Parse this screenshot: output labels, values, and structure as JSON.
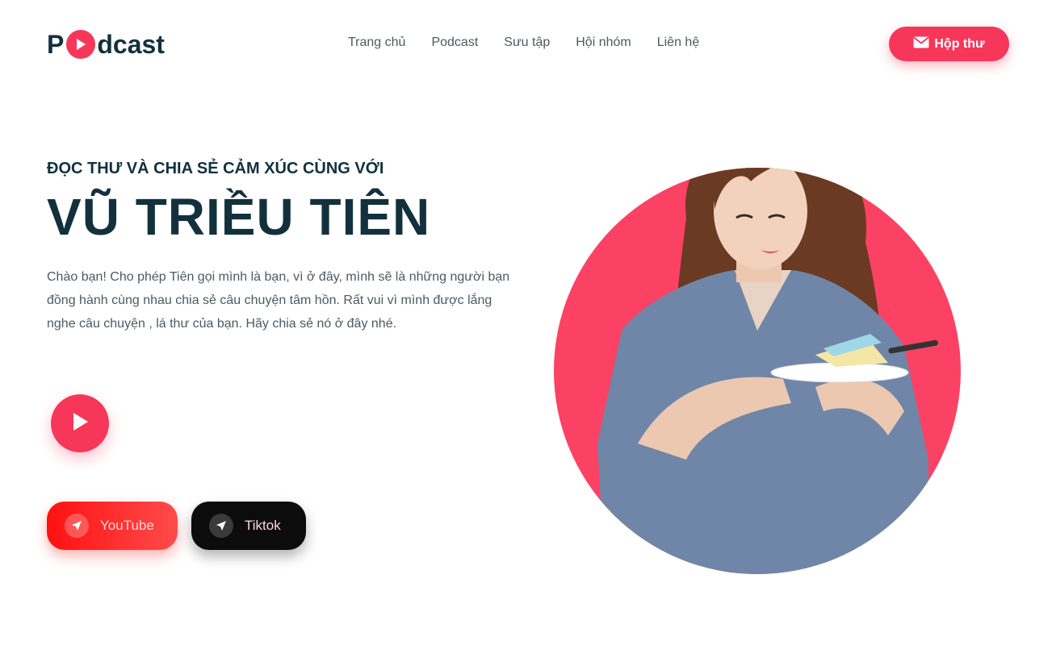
{
  "brand": {
    "logo_prefix": "P",
    "logo_suffix": "dcast",
    "logo_icon": "play-icon"
  },
  "nav": {
    "items": [
      {
        "label": "Trang chủ"
      },
      {
        "label": "Podcast"
      },
      {
        "label": "Sưu tập"
      },
      {
        "label": "Hội nhóm"
      },
      {
        "label": "Liên hệ"
      }
    ]
  },
  "header": {
    "inbox_label": "Hộp thư",
    "inbox_icon": "envelope-icon"
  },
  "hero": {
    "kicker": "ĐỌC THƯ VÀ CHIA SẺ CẢM XÚC CÙNG VỚI",
    "name": "VŨ TRIỀU TIÊN",
    "description": "Chào bạn! Cho phép Tiên gọi mình là bạn, vì ở đây, mình sẽ là những người bạn đồng hành cùng nhau chia sẻ câu chuyện tâm hồn. Rất vui vì mình được lắng nghe câu chuyện , lá thư của bạn. Hãy chia sẻ nó ở đây nhé.",
    "play_icon": "play-icon"
  },
  "social": [
    {
      "label": "YouTube",
      "icon": "send-icon"
    },
    {
      "label": "Tiktok",
      "icon": "send-icon"
    }
  ],
  "colors": {
    "accent": "#f7375a",
    "heading": "#12313d",
    "body_text": "#4b5a63",
    "youtube": "#ff1111",
    "tiktok": "#0c0c0c"
  }
}
